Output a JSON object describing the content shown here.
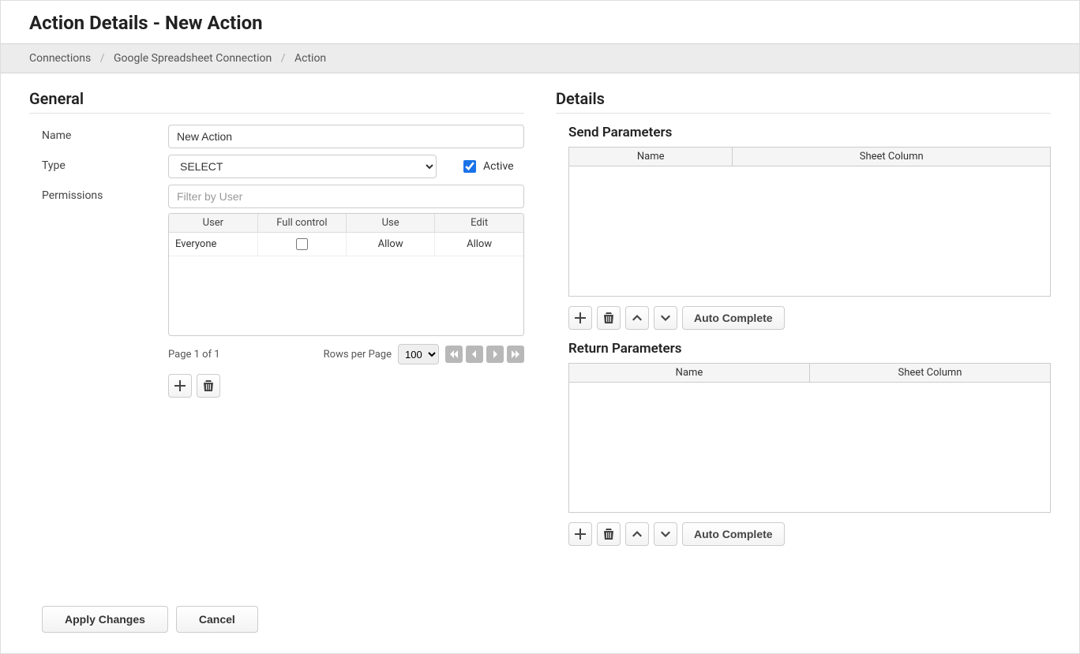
{
  "page_title": "Action Details - New Action",
  "breadcrumb": {
    "items": [
      "Connections",
      "Google Spreadsheet Connection",
      "Action"
    ]
  },
  "general": {
    "heading": "General",
    "name_label": "Name",
    "name_value": "New Action",
    "type_label": "Type",
    "type_value": "SELECT",
    "type_options": [
      "SELECT"
    ],
    "active_label": "Active",
    "active_checked": true,
    "permissions_label": "Permissions",
    "filter_placeholder": "Filter by User",
    "perm_headers": [
      "User",
      "Full control",
      "Use",
      "Edit"
    ],
    "perm_rows": [
      {
        "user": "Everyone",
        "full_control": false,
        "use": "Allow",
        "edit": "Allow"
      }
    ],
    "pager_text": "Page 1 of 1",
    "rows_per_page_label": "Rows per Page",
    "rows_per_page_value": "100",
    "rows_per_page_options": [
      "100"
    ]
  },
  "details": {
    "heading": "Details",
    "send_heading": "Send Parameters",
    "return_heading": "Return Parameters",
    "param_headers": [
      "Name",
      "Sheet Column"
    ],
    "auto_complete_label": "Auto Complete"
  },
  "footer": {
    "apply_label": "Apply Changes",
    "cancel_label": "Cancel"
  }
}
